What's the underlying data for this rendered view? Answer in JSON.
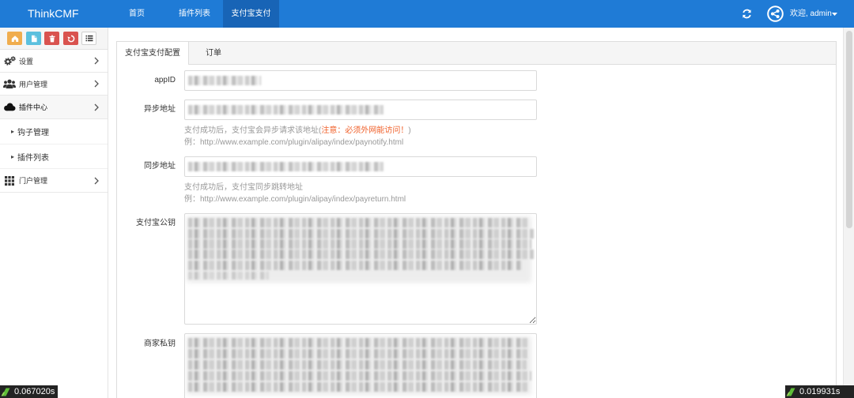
{
  "navbar": {
    "brand": "ThinkCMF",
    "items": [
      {
        "label": "首页",
        "active": false
      },
      {
        "label": "插件列表",
        "active": false
      },
      {
        "label": "支付宝支付",
        "active": true
      }
    ],
    "refresh_icon": "refresh-icon",
    "avatar_icon": "share-alt-icon",
    "user_greeting": "欢迎, admin",
    "dropdown_icon": "caret-down-icon"
  },
  "sidebar": {
    "toolbar": [
      {
        "icon": "home-icon",
        "color": "#f0ad4e"
      },
      {
        "icon": "file-icon",
        "color": "#5bc0de"
      },
      {
        "icon": "trash-icon",
        "color": "#d9534f"
      },
      {
        "icon": "recycle-icon",
        "color": "#d9534f"
      },
      {
        "icon": "list-icon",
        "color": "#ffffff"
      }
    ],
    "menu": [
      {
        "label": "设置",
        "icon": "cogs-icon",
        "expanded": false
      },
      {
        "label": "用户管理",
        "icon": "users-icon",
        "expanded": false
      },
      {
        "label": "插件中心",
        "icon": "cloud-icon",
        "expanded": true,
        "children": [
          {
            "label": "钩子管理"
          },
          {
            "label": "插件列表"
          }
        ]
      },
      {
        "label": "门户管理",
        "icon": "th-icon",
        "expanded": false
      }
    ]
  },
  "tabs": [
    {
      "label": "支付宝支付配置",
      "active": true
    },
    {
      "label": "订单",
      "active": false
    }
  ],
  "form": {
    "app_id": {
      "label": "appID"
    },
    "notify_url": {
      "label": "异步地址",
      "help_prefix": "支付成功后，支付宝会异步请求该地址(",
      "help_warning": "注意：必须外网能访问！",
      "help_suffix": ")",
      "help_example": "例：http://www.example.com/plugin/alipay/index/paynotify.html"
    },
    "return_url": {
      "label": "同步地址",
      "help": "支付成功后，支付宝同步跳转地址",
      "help_example": "例：http://www.example.com/plugin/alipay/index/payreturn.html"
    },
    "alipay_public_key": {
      "label": "支付宝公钥"
    },
    "merchant_private_key": {
      "label": "商家私钥"
    }
  },
  "debug": {
    "left_time": "0.067020s",
    "right_time": "0.019931s"
  },
  "colors": {
    "navbar": "#1f7bd6",
    "navbar_active": "#1864b6",
    "warning_text": "#f0602a",
    "help_text": "#999999"
  }
}
